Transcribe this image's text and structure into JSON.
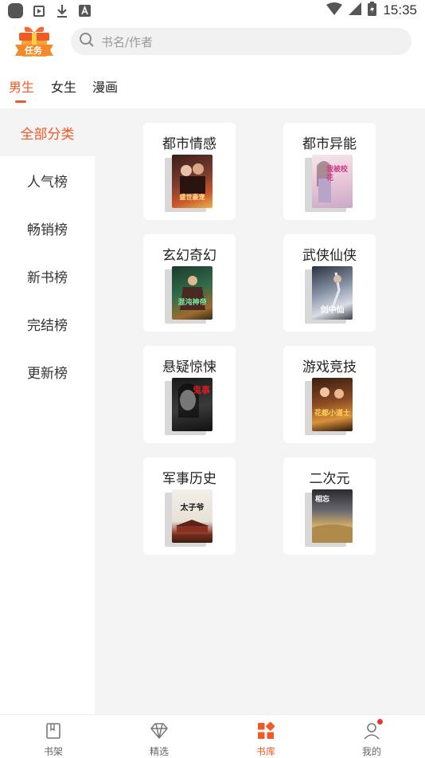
{
  "status_bar": {
    "time": "15:35",
    "left_icons": [
      "app-icon",
      "media-icon",
      "download-icon",
      "a-icon"
    ],
    "right_icons": [
      "wifi-icon",
      "signal-icon",
      "battery-icon"
    ]
  },
  "header": {
    "task_badge_label": "任务",
    "search_placeholder": "书名/作者"
  },
  "tabs": [
    {
      "label": "男生",
      "active": true
    },
    {
      "label": "女生",
      "active": false
    },
    {
      "label": "漫画",
      "active": false
    }
  ],
  "sidebar": {
    "items": [
      {
        "label": "全部分类",
        "active": true
      },
      {
        "label": "人气榜",
        "active": false
      },
      {
        "label": "畅销榜",
        "active": false
      },
      {
        "label": "新书榜",
        "active": false
      },
      {
        "label": "完结榜",
        "active": false
      },
      {
        "label": "更新榜",
        "active": false
      }
    ]
  },
  "categories": [
    {
      "title": "都市情感",
      "cover_text": "盛世豪宠"
    },
    {
      "title": "都市异能",
      "cover_text": "我被校花"
    },
    {
      "title": "玄幻奇幻",
      "cover_text": "混沌神帝"
    },
    {
      "title": "武侠仙侠",
      "cover_text": "剑中仙"
    },
    {
      "title": "悬疑惊悚",
      "cover_text": "鬼事"
    },
    {
      "title": "游戏竞技",
      "cover_text": "花都小道士"
    },
    {
      "title": "军事历史",
      "cover_text": "太子爷"
    },
    {
      "title": "二次元",
      "cover_text": "相忘"
    }
  ],
  "bottom_nav": [
    {
      "label": "书架",
      "icon": "bookshelf-icon",
      "active": false
    },
    {
      "label": "精选",
      "icon": "diamond-icon",
      "active": false
    },
    {
      "label": "书库",
      "icon": "library-grid-icon",
      "active": true
    },
    {
      "label": "我的",
      "icon": "user-icon",
      "active": false,
      "badge": true
    }
  ],
  "colors": {
    "accent": "#f05a24",
    "badge": "#ee3333",
    "background": "#f4f4f4"
  }
}
